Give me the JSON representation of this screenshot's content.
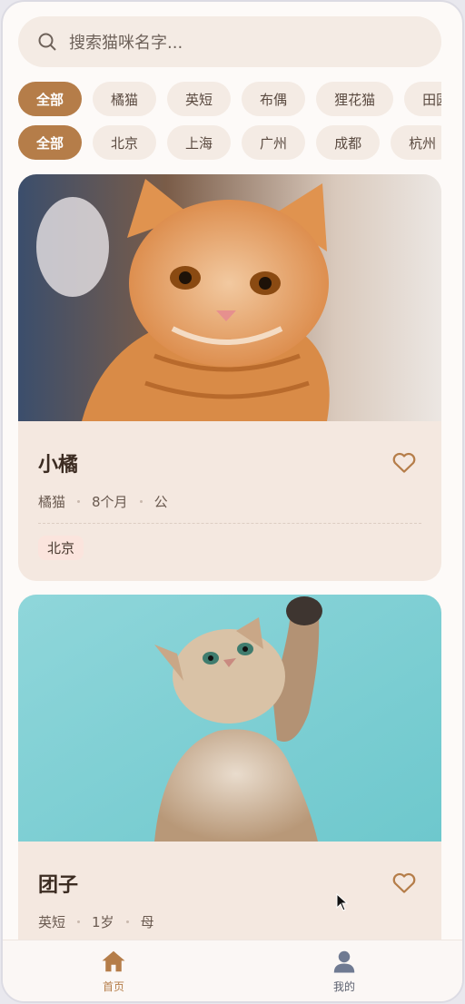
{
  "search": {
    "placeholder": "搜索猫咪名字..."
  },
  "breeds": [
    "全部",
    "橘猫",
    "英短",
    "布偶",
    "狸花猫",
    "田园"
  ],
  "cities": [
    "全部",
    "北京",
    "上海",
    "广州",
    "成都",
    "杭州"
  ],
  "cards": [
    {
      "name": "小橘",
      "breed": "橘猫",
      "age": "8个月",
      "gender": "公",
      "city": "北京",
      "favorited": false
    },
    {
      "name": "团子",
      "breed": "英短",
      "age": "1岁",
      "gender": "母",
      "favorited": false
    }
  ],
  "tabs": {
    "home": "首页",
    "mine": "我的"
  },
  "colors": {
    "accent": "#b57d49",
    "inactive_tab": "#6f7a92"
  },
  "icons": {
    "search": "search-icon",
    "heart": "heart-icon",
    "home": "home-icon",
    "user": "user-icon"
  }
}
